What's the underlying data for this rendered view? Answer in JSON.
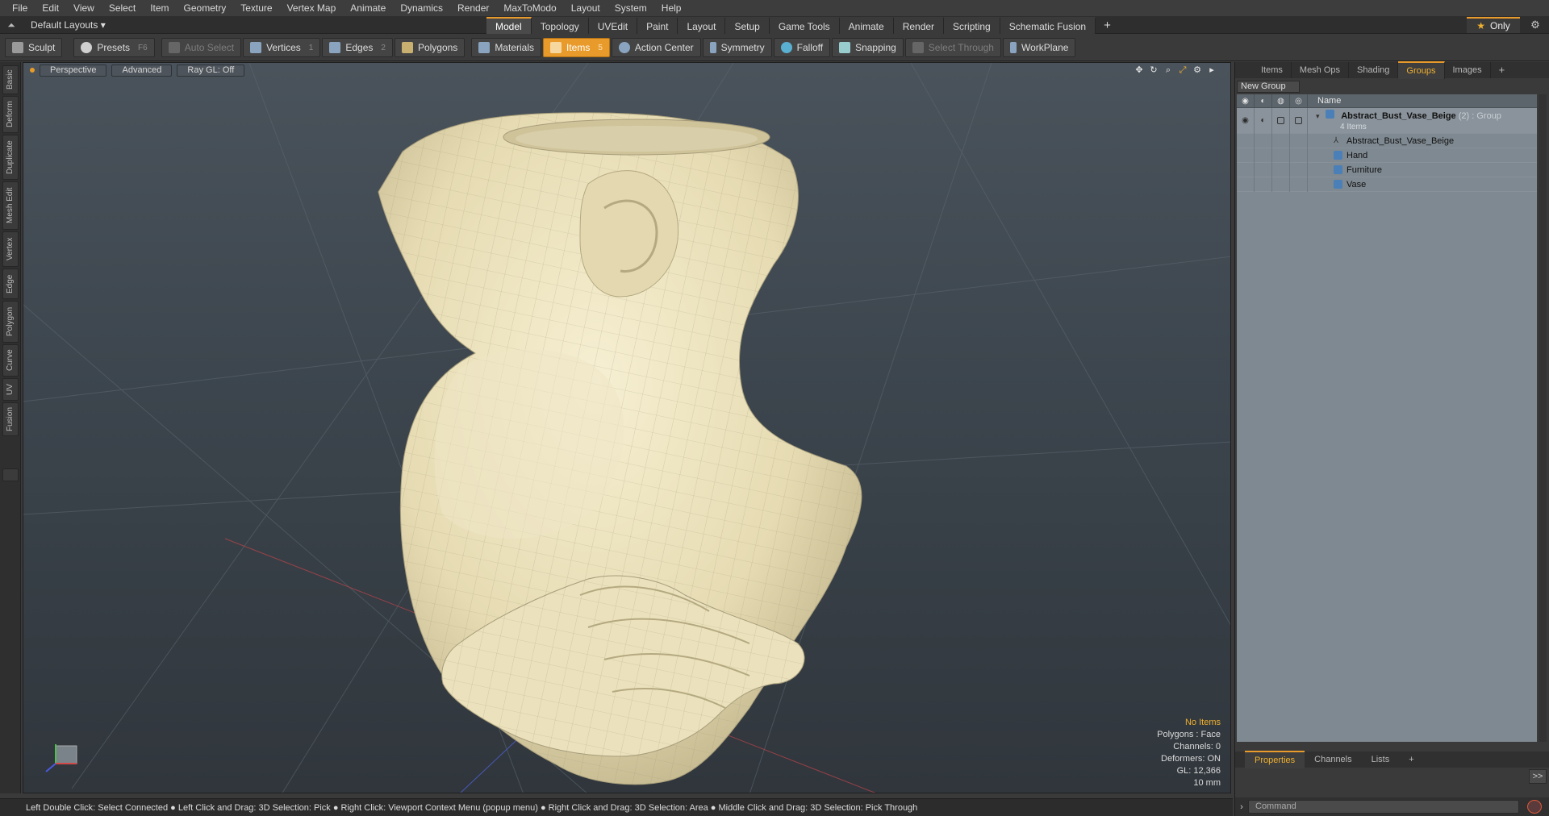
{
  "menu": [
    "File",
    "Edit",
    "View",
    "Select",
    "Item",
    "Geometry",
    "Texture",
    "Vertex Map",
    "Animate",
    "Dynamics",
    "Render",
    "MaxToModo",
    "Layout",
    "System",
    "Help"
  ],
  "layout_selector": "Default Layouts ▾",
  "mode_tabs": [
    "Model",
    "Topology",
    "UVEdit",
    "Paint",
    "Layout",
    "Setup",
    "Game Tools",
    "Animate",
    "Render",
    "Scripting",
    "Schematic Fusion"
  ],
  "active_mode": "Model",
  "only_label": "Only",
  "toolbar": {
    "sculpt": "Sculpt",
    "presets": "Presets",
    "presets_key": "F6",
    "auto_select": "Auto Select",
    "vertices": "Vertices",
    "vertices_key": "1",
    "edges": "Edges",
    "edges_key": "2",
    "polygons": "Polygons",
    "materials": "Materials",
    "items": "Items",
    "items_key": "5",
    "action_center": "Action Center",
    "symmetry": "Symmetry",
    "falloff": "Falloff",
    "snapping": "Snapping",
    "select_through": "Select Through",
    "workplane": "WorkPlane"
  },
  "left_tabs": [
    "Basic",
    "Deform",
    "Duplicate",
    "Mesh Edit",
    "Vertex",
    "Edge",
    "Polygon",
    "Curve",
    "UV",
    "Fusion"
  ],
  "viewport": {
    "view": "Perspective",
    "shading": "Advanced",
    "raygl": "Ray GL: Off",
    "info_status": "No Items",
    "info_polygons": "Polygons : Face",
    "info_channels": "Channels: 0",
    "info_deformers": "Deformers: ON",
    "info_gl": "GL: 12,366",
    "info_scale": "10 mm"
  },
  "status_bar": "Left Double Click: Select Connected ● Left Click and Drag: 3D Selection: Pick ● Right Click: Viewport Context Menu (popup menu) ● Right Click and Drag: 3D Selection: Area ● Middle Click and Drag: 3D Selection: Pick Through",
  "right_panel": {
    "tabs": [
      "Items",
      "Mesh Ops",
      "Shading",
      "Groups",
      "Images"
    ],
    "active_tab": "Groups",
    "new_group": "New Group",
    "name_header": "Name",
    "group_name": "Abstract_Bust_Vase_Beige",
    "group_meta": " (2) : Group",
    "group_count": "4 Items",
    "children": [
      "Abstract_Bust_Vase_Beige",
      "Hand",
      "Furniture",
      "Vase"
    ],
    "bottom_tabs": [
      "Properties",
      "Channels",
      "Lists"
    ],
    "active_bottom_tab": "Properties",
    "command_placeholder": "Command",
    "expand_label": ">>"
  },
  "colors": {
    "accent": "#e89b2b",
    "model": "#ece3bf"
  }
}
